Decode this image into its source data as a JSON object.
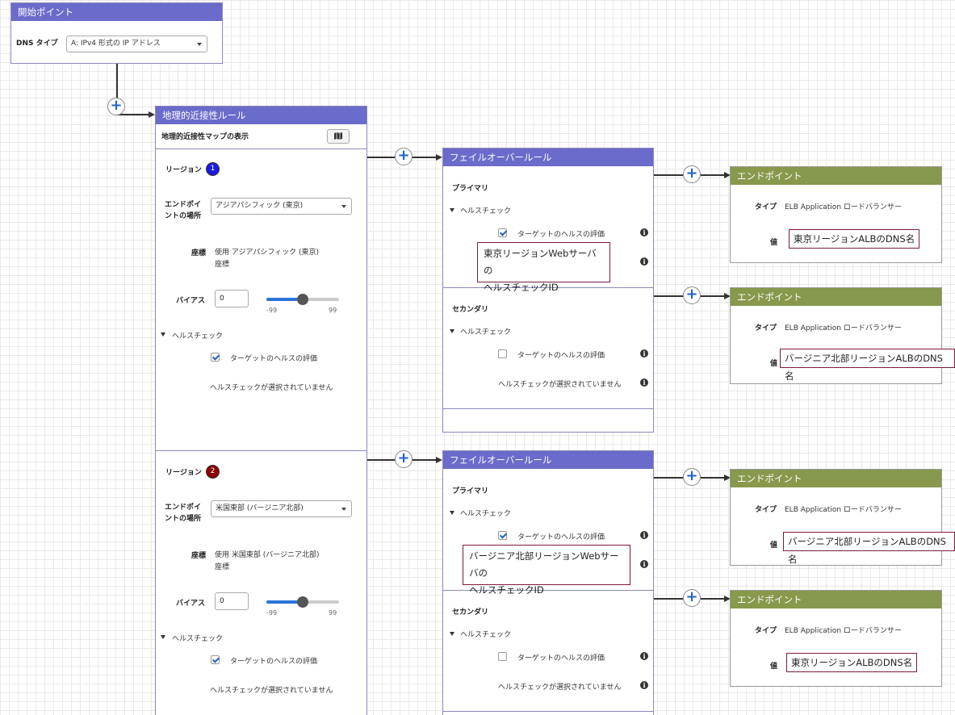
{
  "start": {
    "title": "開始ポイント",
    "dns_type_label": "DNS タイプ",
    "dns_type_value": "A: IPv4 形式の IP アドレス"
  },
  "geo": {
    "title": "地理的近接性ルール",
    "map_label": "地理的近接性マップの表示",
    "regions": [
      {
        "label": "リージョン",
        "badge": "1",
        "badge_color": "#1a1ae0",
        "endpoint_location_label_1": "エンドポイ",
        "endpoint_location_label_2": "ントの場所",
        "endpoint_location_value": "アジアパシフィック (東京)",
        "coords_label": "座標",
        "coords_value_1": "使用 アジアパシフィック (東京)",
        "coords_value_2": "座標",
        "bias_label": "バイアス",
        "bias_value": "0",
        "slider_min": "-99",
        "slider_max": "99",
        "health_toggle": "ヘルスチェック",
        "eval_label": "ターゲットのヘルスの評価",
        "eval_checked": true,
        "no_health": "ヘルスチェックが選択されていません"
      },
      {
        "label": "リージョン",
        "badge": "2",
        "badge_color": "#8b0000",
        "endpoint_location_label_1": "エンドポイ",
        "endpoint_location_label_2": "ントの場所",
        "endpoint_location_value": "米国東部 (バージニア北部)",
        "coords_label": "座標",
        "coords_value_1": "使用 米国東部 (バージニア北部)",
        "coords_value_2": "座標",
        "bias_label": "バイアス",
        "bias_value": "0",
        "slider_min": "-99",
        "slider_max": "99",
        "health_toggle": "ヘルスチェック",
        "eval_label": "ターゲットのヘルスの評価",
        "eval_checked": true,
        "no_health": "ヘルスチェックが選択されていません"
      }
    ]
  },
  "failovers": [
    {
      "title": "フェイルオーバールール",
      "primary_label": "プライマリ",
      "primary_health_toggle": "ヘルスチェック",
      "primary_eval_label": "ターゲットのヘルスの評価",
      "primary_annot_1": "東京リージョンWebサーバの",
      "primary_annot_2": "ヘルスチェックID",
      "secondary_label": "セカンダリ",
      "secondary_health_toggle": "ヘルスチェック",
      "secondary_eval_label": "ターゲットのヘルスの評価",
      "secondary_no_health": "ヘルスチェックが選択されていません"
    },
    {
      "title": "フェイルオーバールール",
      "primary_label": "プライマリ",
      "primary_health_toggle": "ヘルスチェック",
      "primary_eval_label": "ターゲットのヘルスの評価",
      "primary_annot_1": "バージニア北部リージョンWebサーバの",
      "primary_annot_2": "ヘルスチェックID",
      "secondary_label": "セカンダリ",
      "secondary_health_toggle": "ヘルスチェック",
      "secondary_eval_label": "ターゲットのヘルスの評価",
      "secondary_no_health": "ヘルスチェックが選択されていません"
    }
  ],
  "endpoints": [
    {
      "title": "エンドポイント",
      "type_label": "タイプ",
      "type_value": "ELB Application ロードバランサー",
      "value_label": "値",
      "value": "東京リージョンALBのDNS名"
    },
    {
      "title": "エンドポイント",
      "type_label": "タイプ",
      "type_value": "ELB Application ロードバランサー",
      "value_label": "値",
      "value": "バージニア北部リージョンALBのDNS名"
    },
    {
      "title": "エンドポイント",
      "type_label": "タイプ",
      "type_value": "ELB Application ロードバランサー",
      "value_label": "値",
      "value": "バージニア北部リージョンALBのDNS名"
    },
    {
      "title": "エンドポイント",
      "type_label": "タイプ",
      "type_value": "ELB Application ロードバランサー",
      "value_label": "値",
      "value": "東京リージョンALBのDNS名"
    }
  ],
  "icons": {
    "plus": "+",
    "info": "i",
    "map": "map-icon"
  }
}
